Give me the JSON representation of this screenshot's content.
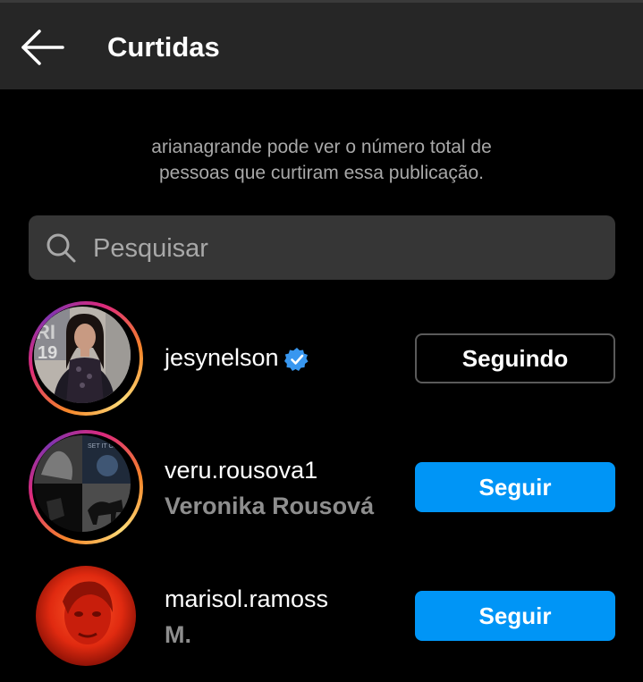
{
  "header": {
    "title": "Curtidas",
    "back_icon": "back-arrow-icon"
  },
  "notice": {
    "line1": "arianagrande pode ver o número total de",
    "line2": "pessoas que curtiram essa publicação."
  },
  "search": {
    "placeholder": "Pesquisar",
    "value": "",
    "icon": "search-icon"
  },
  "users": [
    {
      "username": "jesynelson",
      "full_name": "",
      "verified": true,
      "story_ring": true,
      "button_label": "Seguindo"
    },
    {
      "username": "veru.rousova1",
      "full_name": "Veronika Rousová",
      "verified": false,
      "story_ring": true,
      "button_label": "Seguir"
    },
    {
      "username": "marisol.ramoss",
      "full_name": "M.",
      "verified": false,
      "story_ring": false,
      "button_label": "Seguir"
    }
  ],
  "colors": {
    "background": "#000000",
    "header_bg": "#262626",
    "search_bg": "#363636",
    "follow_button": "#0095f6",
    "muted_text": "#a8a8a8",
    "verified_badge": "#3897f0"
  }
}
